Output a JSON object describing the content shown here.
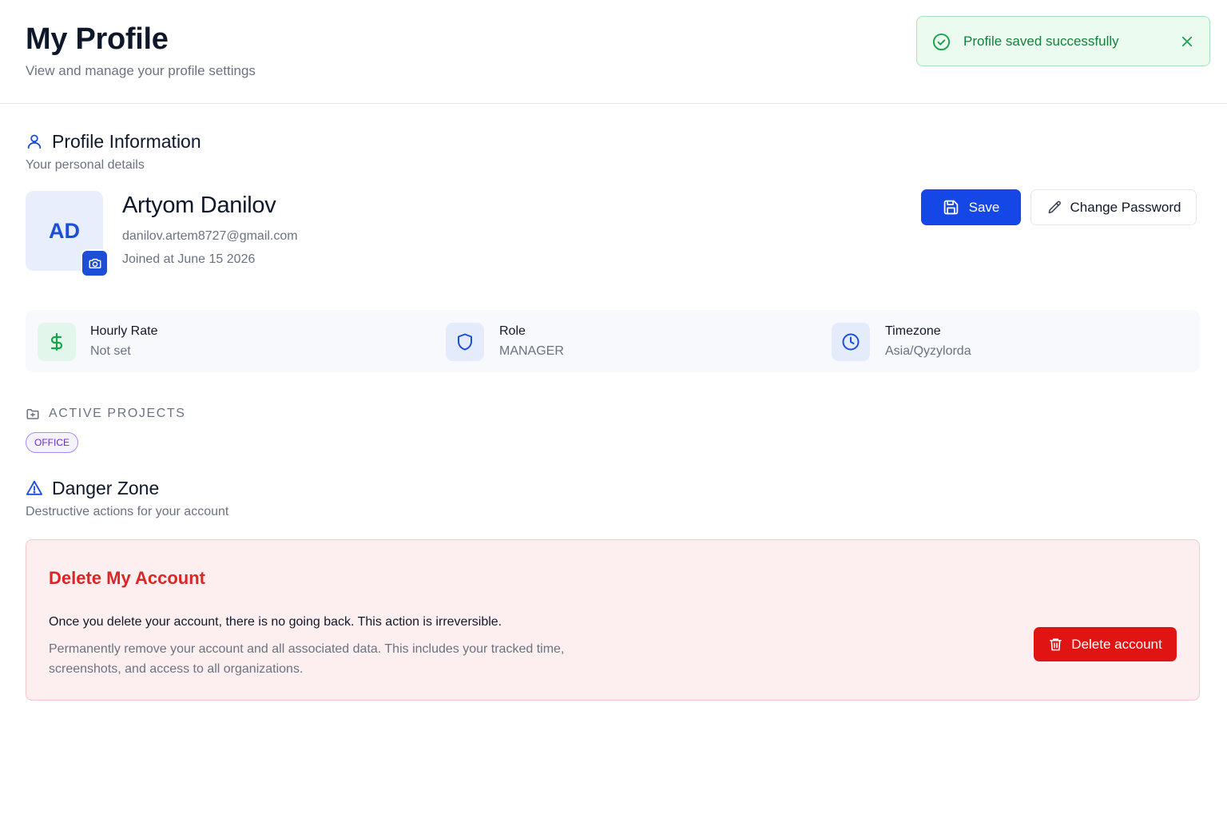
{
  "header": {
    "title": "My Profile",
    "subtitle": "View and manage your profile settings"
  },
  "toast": {
    "message": "Profile saved successfully",
    "icon": "check-circle-icon",
    "close_icon": "close-icon"
  },
  "profile_section": {
    "title": "Profile Information",
    "subtitle": "Your personal details",
    "icon": "user-icon"
  },
  "user": {
    "initials": "AD",
    "name": "Artyom Danilov",
    "email": "danilov.artem8727@gmail.com",
    "joined": "Joined at June 15 2026"
  },
  "actions": {
    "save_label": "Save",
    "change_password_label": "Change Password"
  },
  "info": [
    {
      "label": "Hourly Rate",
      "value": "Not set",
      "icon": "dollar-icon"
    },
    {
      "label": "Role",
      "value": "MANAGER",
      "icon": "shield-icon"
    },
    {
      "label": "Timezone",
      "value": "Asia/Qyzylorda",
      "icon": "clock-icon"
    }
  ],
  "active_projects": {
    "title": "ACTIVE PROJECTS",
    "icon": "folder-icon",
    "tags": [
      "OFFICE"
    ]
  },
  "danger_zone": {
    "title": "Danger Zone",
    "subtitle": "Destructive actions for your account",
    "icon": "warning-triangle-icon",
    "box_title": "Delete My Account",
    "warning": "Once you delete your account, there is no going back. This action is irreversible.",
    "description": "Permanently remove your account and all associated data.  This includes your tracked time, screenshots, and access to all organizations.",
    "button_label": "Delete account"
  },
  "colors": {
    "primary": "#1447e6",
    "success": "#15803d",
    "danger": "#dc2626",
    "tag": "#6d28d9"
  }
}
